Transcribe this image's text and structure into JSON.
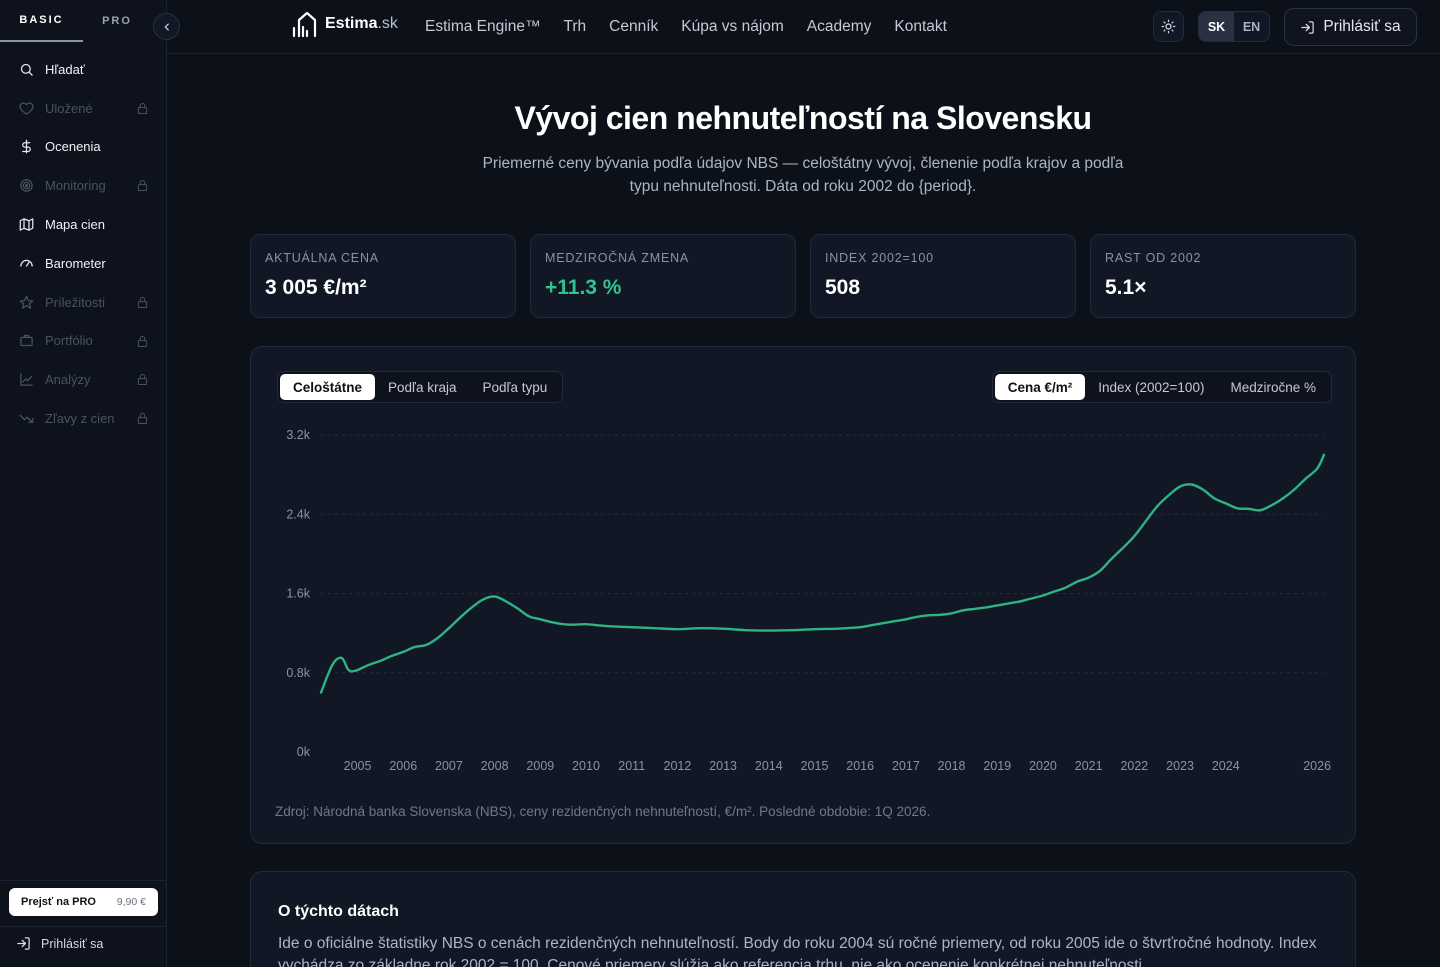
{
  "sidebar": {
    "tabs": [
      "BASIC",
      "PRO"
    ],
    "items": [
      {
        "label": "Hľadať",
        "icon": "search-icon",
        "locked": false
      },
      {
        "label": "Uložené",
        "icon": "heart-icon",
        "locked": true
      },
      {
        "label": "Ocenenia",
        "icon": "dollar-icon",
        "locked": false
      },
      {
        "label": "Monitoring",
        "icon": "radar-icon",
        "locked": true
      },
      {
        "label": "Mapa cien",
        "icon": "map-icon",
        "locked": false
      },
      {
        "label": "Barometer",
        "icon": "gauge-icon",
        "locked": false
      },
      {
        "label": "Príležitosti",
        "icon": "star-icon",
        "locked": true
      },
      {
        "label": "Portfólio",
        "icon": "briefcase-icon",
        "locked": true
      },
      {
        "label": "Analýzy",
        "icon": "chart-icon",
        "locked": true
      },
      {
        "label": "Zľavy z cien",
        "icon": "trend-down-icon",
        "locked": true
      }
    ],
    "pro_button": {
      "label": "Prejsť na PRO",
      "price": "9,90 €"
    },
    "login": "Prihlásiť sa"
  },
  "topbar": {
    "logo_name": "Estima",
    "logo_tld": ".sk",
    "nav": [
      "Estima Engine™",
      "Trh",
      "Cenník",
      "Kúpa vs nájom",
      "Academy",
      "Kontakt"
    ],
    "lang": [
      "SK",
      "EN"
    ],
    "login": "Prihlásiť sa"
  },
  "hero": {
    "title": "Vývoj cien nehnuteľností na Slovensku",
    "subtitle": "Priemerné ceny bývania podľa údajov NBS — celoštátny vývoj, členenie podľa krajov a podľa typu nehnuteľnosti. Dáta od roku 2002 do {period}."
  },
  "stats": [
    {
      "label": "AKTUÁLNA CENA",
      "value": "3 005 €/m²",
      "accent": false
    },
    {
      "label": "MEDZIROČNÁ ZMENA",
      "value": "+11.3 %",
      "accent": true
    },
    {
      "label": "INDEX 2002=100",
      "value": "508",
      "accent": false
    },
    {
      "label": "RAST OD 2002",
      "value": "5.1×",
      "accent": false
    }
  ],
  "chart_tabs": {
    "scope": [
      "Celoštátne",
      "Podľa kraja",
      "Podľa typu"
    ],
    "metric": [
      "Cena €/m²",
      "Index (2002=100)",
      "Medziročne %"
    ]
  },
  "chart_data": {
    "type": "line",
    "title": "",
    "xlabel": "",
    "ylabel": "",
    "ylim": [
      0,
      3200
    ],
    "yticks": [
      "0k",
      "0.8k",
      "1.6k",
      "2.4k",
      "3.2k"
    ],
    "ytick_values": [
      0,
      800,
      1600,
      2400,
      3200
    ],
    "xticks": [
      "2005",
      "2006",
      "2007",
      "2008",
      "2009",
      "2010",
      "2011",
      "2012",
      "2013",
      "2014",
      "2015",
      "2016",
      "2017",
      "2018",
      "2019",
      "2020",
      "2021",
      "2022",
      "2023",
      "2024",
      "2026"
    ],
    "xtick_values": [
      2005,
      2006,
      2007,
      2008,
      2009,
      2010,
      2011,
      2012,
      2013,
      2014,
      2015,
      2016,
      2017,
      2018,
      2019,
      2020,
      2021,
      2022,
      2023,
      2024,
      2026
    ],
    "xlim": [
      2004.2,
      2026.15
    ],
    "grid": true,
    "color": "#2fb383",
    "series": [
      {
        "x": [
          2004.2,
          2004.45,
          2004.65,
          2004.8,
          2004.95,
          2005.25,
          2005.5,
          2005.75,
          2006,
          2006.25,
          2006.5,
          2006.75,
          2007,
          2007.25,
          2007.5,
          2007.75,
          2008,
          2008.25,
          2008.5,
          2008.75,
          2009,
          2009.25,
          2009.5,
          2009.75,
          2010,
          2010.5,
          2011,
          2011.5,
          2012,
          2012.5,
          2013,
          2013.5,
          2014,
          2014.5,
          2015,
          2015.5,
          2016,
          2016.25,
          2016.5,
          2016.75,
          2017,
          2017.25,
          2017.5,
          2017.75,
          2018,
          2018.25,
          2018.5,
          2018.75,
          2019,
          2019.25,
          2019.5,
          2019.75,
          2020,
          2020.25,
          2020.5,
          2020.75,
          2021,
          2021.25,
          2021.5,
          2021.75,
          2022,
          2022.25,
          2022.5,
          2022.75,
          2023,
          2023.25,
          2023.5,
          2023.75,
          2024,
          2024.25,
          2024.5,
          2024.75,
          2025,
          2025.25,
          2025.5,
          2025.75,
          2026,
          2026.15
        ],
        "y": [
          600,
          880,
          950,
          830,
          820,
          880,
          920,
          970,
          1010,
          1060,
          1080,
          1150,
          1250,
          1360,
          1460,
          1540,
          1570,
          1520,
          1450,
          1370,
          1340,
          1310,
          1290,
          1285,
          1290,
          1270,
          1260,
          1250,
          1240,
          1250,
          1245,
          1230,
          1225,
          1230,
          1240,
          1245,
          1260,
          1280,
          1300,
          1320,
          1340,
          1365,
          1380,
          1385,
          1400,
          1430,
          1445,
          1460,
          1480,
          1500,
          1520,
          1550,
          1580,
          1620,
          1660,
          1720,
          1760,
          1830,
          1950,
          2060,
          2180,
          2330,
          2480,
          2590,
          2680,
          2700,
          2650,
          2560,
          2510,
          2460,
          2455,
          2440,
          2490,
          2560,
          2650,
          2760,
          2860,
          3000
        ]
      }
    ]
  },
  "source": "Zdroj: Národná banka Slovenska (NBS), ceny rezidenčných nehnuteľností, €/m². Posledné obdobie: 1Q 2026.",
  "about": {
    "title": "O týchto dátach",
    "text": "Ide o oficiálne štatistiky NBS o cenách rezidenčných nehnuteľností. Body do roku 2004 sú ročné priemery, od roku 2005 ide o štvrťročné hodnoty. Index vychádza zo základne rok 2002 = 100. Cenové priemery slúžia ako referencia trhu, nie ako ocenenie konkrétnej nehnuteľnosti."
  }
}
